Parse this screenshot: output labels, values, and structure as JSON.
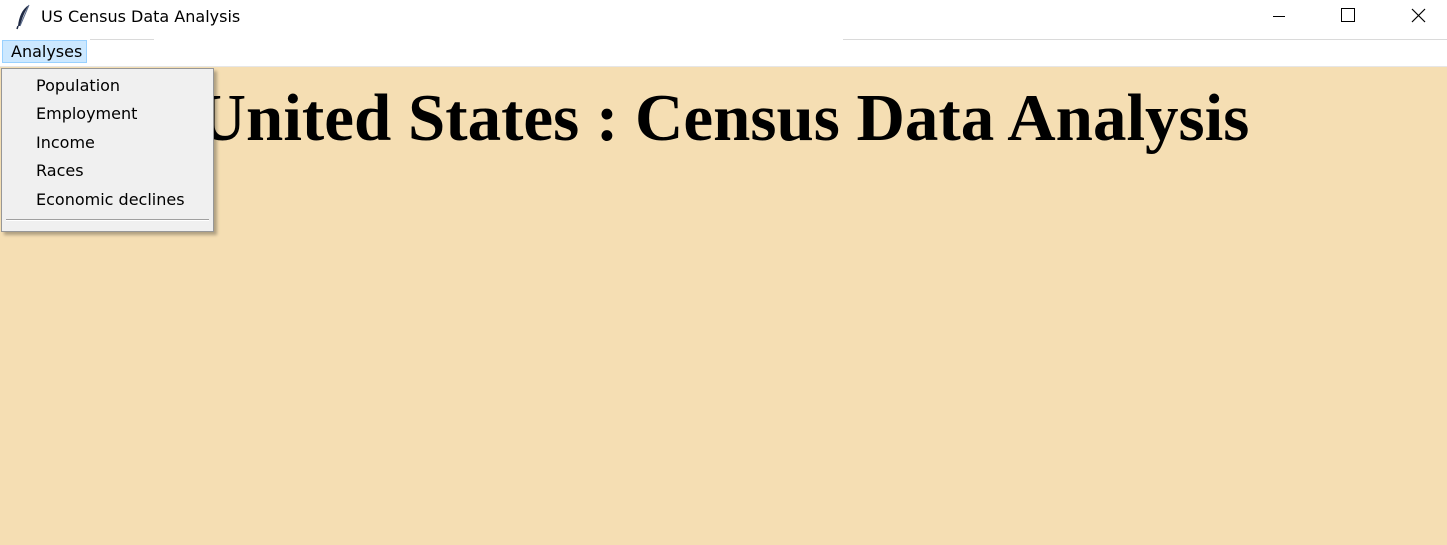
{
  "window": {
    "title": "US Census Data Analysis",
    "icon": "feather-icon",
    "controls": [
      "minimize-icon",
      "maximize-icon",
      "close-icon"
    ]
  },
  "menubar": {
    "items": [
      {
        "label": "Analyses",
        "state": "open"
      }
    ]
  },
  "dropdown": {
    "items": [
      {
        "label": "Population"
      },
      {
        "label": "Employment"
      },
      {
        "label": "Income"
      },
      {
        "label": "Races"
      },
      {
        "label": "Economic declines"
      }
    ]
  },
  "content": {
    "heading": "United States : Census Data Analysis",
    "background_color": "#f5deb3"
  }
}
